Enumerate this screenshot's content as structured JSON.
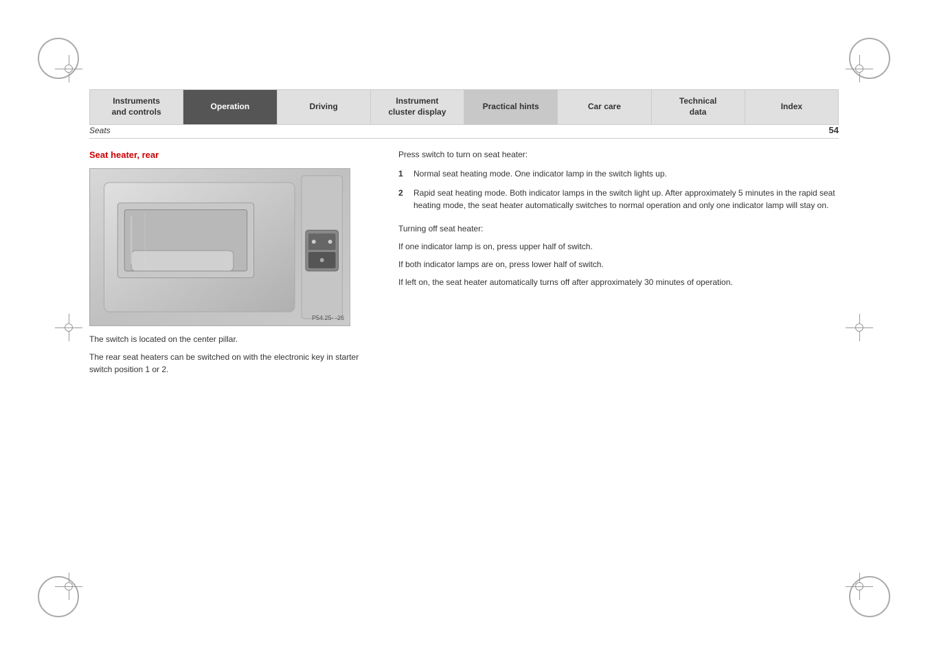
{
  "nav": {
    "items": [
      {
        "id": "instruments-controls",
        "label": "Instruments\nand controls",
        "state": "normal"
      },
      {
        "id": "operation",
        "label": "Operation",
        "state": "active"
      },
      {
        "id": "driving",
        "label": "Driving",
        "state": "normal"
      },
      {
        "id": "instrument-cluster-display",
        "label": "Instrument\ncluster display",
        "state": "normal"
      },
      {
        "id": "practical-hints",
        "label": "Practical hints",
        "state": "highlight"
      },
      {
        "id": "car-care",
        "label": "Car care",
        "state": "normal"
      },
      {
        "id": "technical-data",
        "label": "Technical\ndata",
        "state": "normal"
      },
      {
        "id": "index",
        "label": "Index",
        "state": "normal"
      }
    ]
  },
  "page": {
    "section": "Seats",
    "page_number": "54",
    "heading": "Seat heater, rear",
    "image_caption": "P54.25-  -26",
    "caption_line1": "The switch is located on the center pillar.",
    "caption_line2": "The rear seat heaters can be switched on with the electronic key in starter switch position 1 or 2.",
    "press_switch_label": "Press switch to turn on seat heater:",
    "list_items": [
      {
        "num": "1",
        "text": "Normal seat heating mode. One indicator lamp in the switch lights up."
      },
      {
        "num": "2",
        "text": "Rapid seat heating mode. Both indicator lamps in the switch light up. After approximately 5 minutes in the rapid seat heating mode, the seat heater automatically switches to normal operation and only one indicator lamp will stay on."
      }
    ],
    "turning_off_label": "Turning off seat heater:",
    "turning_off_line1": "If one indicator lamp is on, press upper half of switch.",
    "turning_off_line2": "If both indicator lamps are on, press lower half of switch.",
    "turning_off_line3": "If left on, the seat heater automatically turns off after approximately 30 minutes of operation."
  }
}
